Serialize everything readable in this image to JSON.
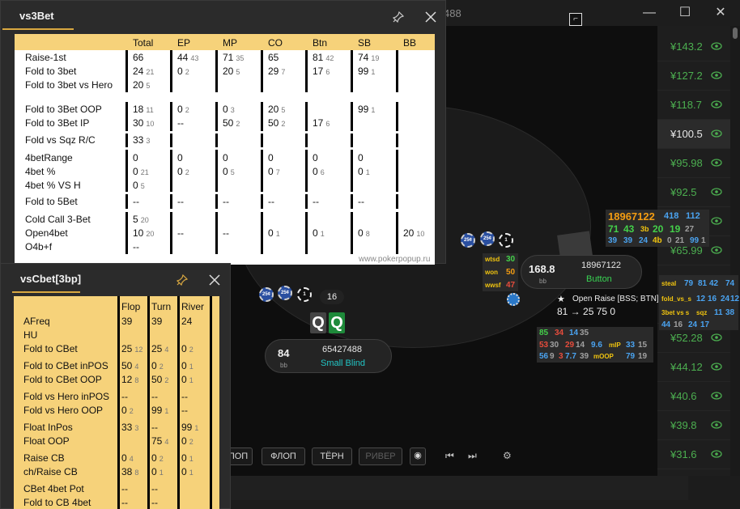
{
  "window": {
    "title": "488"
  },
  "tourney_list": {
    "amounts": [
      "¥143.2",
      "¥127.2",
      "¥118.7",
      "¥100.5",
      "¥95.98",
      "¥92.5",
      "",
      "¥65.99",
      "",
      "",
      "¥52.28",
      "¥44.12",
      "¥40.6",
      "¥39.8",
      "¥31.6"
    ],
    "selected_index": 3
  },
  "table": {
    "hero": {
      "stack": "84",
      "bb": "bb",
      "name": "65427488",
      "position": "Small Blind"
    },
    "villain": {
      "stack": "168.8",
      "bb": "bb",
      "name": "18967122",
      "position": "Button"
    },
    "hero_bet": "16",
    "hero_cards": [
      "Q",
      "Q"
    ],
    "villain_chips": [
      "25¢",
      "25¢",
      "1"
    ],
    "hero_chips": [
      "25¢",
      "25¢",
      "1"
    ],
    "action_line1": "Open Raise [BSS; BTN]",
    "action_line2": "81  →  25  75  0",
    "streets": [
      "ПОП",
      "ФЛОП",
      "ТЁРН",
      "РИВЕР"
    ]
  },
  "hud_villain": {
    "row1": [
      "18967122",
      "418",
      "112"
    ],
    "row2": [
      "71",
      "43",
      "3b",
      "20",
      "19",
      "27"
    ],
    "row3": [
      "39",
      "39",
      "24",
      "4b",
      "0",
      "21",
      "99",
      "1"
    ],
    "side": [
      [
        "wtsd",
        "30"
      ],
      [
        "won",
        "50"
      ],
      [
        "wwsf",
        "47"
      ]
    ]
  },
  "hud_hero": {
    "row1": [
      "85",
      "34",
      "14",
      "35"
    ],
    "row2": [
      "53",
      "30",
      "29",
      "14",
      "9.6",
      "mIP",
      "33",
      "15"
    ],
    "row3": [
      "56",
      "9",
      "3",
      "7.7",
      "39",
      "mOOP",
      "79",
      "19"
    ]
  },
  "hud_right": {
    "row1": [
      "steal",
      "79",
      "81",
      "42",
      "74"
    ],
    "row2": [
      "fold_vs_s",
      "12",
      "16",
      "24",
      "12"
    ],
    "row3": [
      "3bet vs s",
      "sqz",
      "11",
      "38"
    ],
    "row4": [
      "44",
      "16",
      "24",
      "17"
    ]
  },
  "popup_3bet": {
    "title": "vs3Bet",
    "footer": "www.pokerpopup.ru",
    "columns": [
      "Total",
      "EP",
      "MP",
      "CO",
      "Btn",
      "SB",
      "BB"
    ],
    "rows": [
      {
        "label": "Raise-1st",
        "cells": [
          [
            "66",
            ""
          ],
          [
            "44",
            "43"
          ],
          [
            "71",
            "35"
          ],
          [
            "65",
            ""
          ],
          [
            "81",
            "42"
          ],
          [
            "74",
            "19"
          ],
          [
            "",
            ""
          ]
        ]
      },
      {
        "label": "Fold to 3bet",
        "cells": [
          [
            "24",
            "21"
          ],
          [
            "0",
            "2"
          ],
          [
            "20",
            "5"
          ],
          [
            "29",
            "7"
          ],
          [
            "17",
            "6"
          ],
          [
            "99",
            "1"
          ],
          [
            "",
            ""
          ]
        ]
      },
      {
        "label": "Fold to 3bet vs Hero",
        "cells": [
          [
            "20",
            "5"
          ],
          [
            "",
            ""
          ],
          [
            "",
            ""
          ],
          [
            "",
            ""
          ],
          [
            "",
            ""
          ],
          [
            "",
            ""
          ],
          [
            "",
            ""
          ]
        ]
      },
      {
        "label": "Fold to 3Bet OOP",
        "cells": [
          [
            "18",
            "11"
          ],
          [
            "0",
            "2"
          ],
          [
            "0",
            "3"
          ],
          [
            "20",
            "5"
          ],
          [
            "",
            ""
          ],
          [
            "99",
            "1"
          ],
          [
            "",
            ""
          ]
        ]
      },
      {
        "label": "Fold to 3Bet IP",
        "cells": [
          [
            "30",
            "10"
          ],
          [
            "--",
            ""
          ],
          [
            "50",
            "2"
          ],
          [
            "50",
            "2"
          ],
          [
            "17",
            "6"
          ],
          [
            "",
            ""
          ],
          [
            "",
            ""
          ]
        ]
      },
      {
        "label": "Fold vs Sqz R/C",
        "cells": [
          [
            "33",
            "3"
          ],
          [
            "",
            ""
          ],
          [
            "",
            ""
          ],
          [
            "",
            ""
          ],
          [
            "",
            ""
          ],
          [
            "",
            ""
          ],
          [
            "",
            ""
          ]
        ]
      },
      {
        "label": "4betRange",
        "cells": [
          [
            "0",
            ""
          ],
          [
            "0",
            ""
          ],
          [
            "0",
            ""
          ],
          [
            "0",
            ""
          ],
          [
            "0",
            ""
          ],
          [
            "0",
            ""
          ],
          [
            "",
            ""
          ]
        ]
      },
      {
        "label": "4bet %",
        "cells": [
          [
            "0",
            "21"
          ],
          [
            "0",
            "2"
          ],
          [
            "0",
            "5"
          ],
          [
            "0",
            "7"
          ],
          [
            "0",
            "6"
          ],
          [
            "0",
            "1"
          ],
          [
            "",
            ""
          ]
        ]
      },
      {
        "label": "4bet % VS H",
        "cells": [
          [
            "0",
            "5"
          ],
          [
            "",
            ""
          ],
          [
            "",
            ""
          ],
          [
            "",
            ""
          ],
          [
            "",
            ""
          ],
          [
            "",
            ""
          ],
          [
            "",
            ""
          ]
        ]
      },
      {
        "label": "Fold to 5Bet",
        "cells": [
          [
            "--",
            ""
          ],
          [
            "--",
            ""
          ],
          [
            "--",
            ""
          ],
          [
            "--",
            ""
          ],
          [
            "--",
            ""
          ],
          [
            "--",
            ""
          ],
          [
            "",
            ""
          ]
        ]
      },
      {
        "label": "Cold Call 3-Bet",
        "cells": [
          [
            "5",
            "20"
          ],
          [
            "",
            ""
          ],
          [
            "",
            ""
          ],
          [
            "",
            ""
          ],
          [
            "",
            ""
          ],
          [
            "",
            ""
          ],
          [
            "",
            ""
          ]
        ]
      },
      {
        "label": "Open4bet",
        "cells": [
          [
            "10",
            "20"
          ],
          [
            "--",
            ""
          ],
          [
            "--",
            ""
          ],
          [
            "0",
            "1"
          ],
          [
            "0",
            "1"
          ],
          [
            "0",
            "8"
          ],
          [
            "20",
            "10"
          ]
        ]
      },
      {
        "label": "O4b+f",
        "cells": [
          [
            "--",
            ""
          ],
          [
            "",
            ""
          ],
          [
            "",
            ""
          ],
          [
            "",
            ""
          ],
          [
            "",
            ""
          ],
          [
            "",
            ""
          ],
          [
            "",
            ""
          ]
        ]
      }
    ]
  },
  "popup_cbet": {
    "title": "vsCbet[3bp]",
    "columns": [
      "Flop",
      "Turn",
      "River"
    ],
    "rows": [
      {
        "label": "AFreq",
        "cells": [
          [
            "39",
            ""
          ],
          [
            "39",
            ""
          ],
          [
            "24",
            ""
          ]
        ]
      },
      {
        "label": "HU",
        "cells": [
          [
            "",
            ""
          ],
          [
            "",
            ""
          ],
          [
            "",
            ""
          ]
        ]
      },
      {
        "label": "Fold to CBet",
        "cells": [
          [
            "25",
            "12"
          ],
          [
            "25",
            "4"
          ],
          [
            "0",
            "2"
          ]
        ]
      },
      {
        "label": "Fold to CBet inPOS",
        "cells": [
          [
            "50",
            "4"
          ],
          [
            "0",
            "2"
          ],
          [
            "0",
            "1"
          ]
        ]
      },
      {
        "label": "Fold to CBet OOP",
        "cells": [
          [
            "12",
            "8"
          ],
          [
            "50",
            "2"
          ],
          [
            "0",
            "1"
          ]
        ]
      },
      {
        "label": "Fold vs Hero inPOS",
        "cells": [
          [
            "--",
            ""
          ],
          [
            "--",
            ""
          ],
          [
            "--",
            ""
          ]
        ]
      },
      {
        "label": "Fold vs Hero OOP",
        "cells": [
          [
            "0",
            "2"
          ],
          [
            "99",
            "1"
          ],
          [
            "--",
            ""
          ]
        ]
      },
      {
        "label": "Float InPos",
        "cells": [
          [
            "33",
            "3"
          ],
          [
            "--",
            ""
          ],
          [
            "99",
            "1"
          ]
        ]
      },
      {
        "label": "Float OOP",
        "cells": [
          [
            "",
            ""
          ],
          [
            "75",
            "4"
          ],
          [
            "0",
            "2"
          ]
        ]
      },
      {
        "label": "Raise CB",
        "cells": [
          [
            "0",
            "4"
          ],
          [
            "0",
            "2"
          ],
          [
            "0",
            "1"
          ]
        ]
      },
      {
        "label": "ch/Raise CB",
        "cells": [
          [
            "38",
            "8"
          ],
          [
            "0",
            "1"
          ],
          [
            "0",
            "1"
          ]
        ]
      },
      {
        "label": "CBet 4bet Pot",
        "cells": [
          [
            "--",
            ""
          ],
          [
            "--",
            ""
          ],
          [
            "",
            ""
          ]
        ]
      },
      {
        "label": "Fold to CB 4bet",
        "cells": [
          [
            "--",
            ""
          ],
          [
            "--",
            ""
          ],
          [
            "",
            ""
          ]
        ]
      }
    ]
  }
}
